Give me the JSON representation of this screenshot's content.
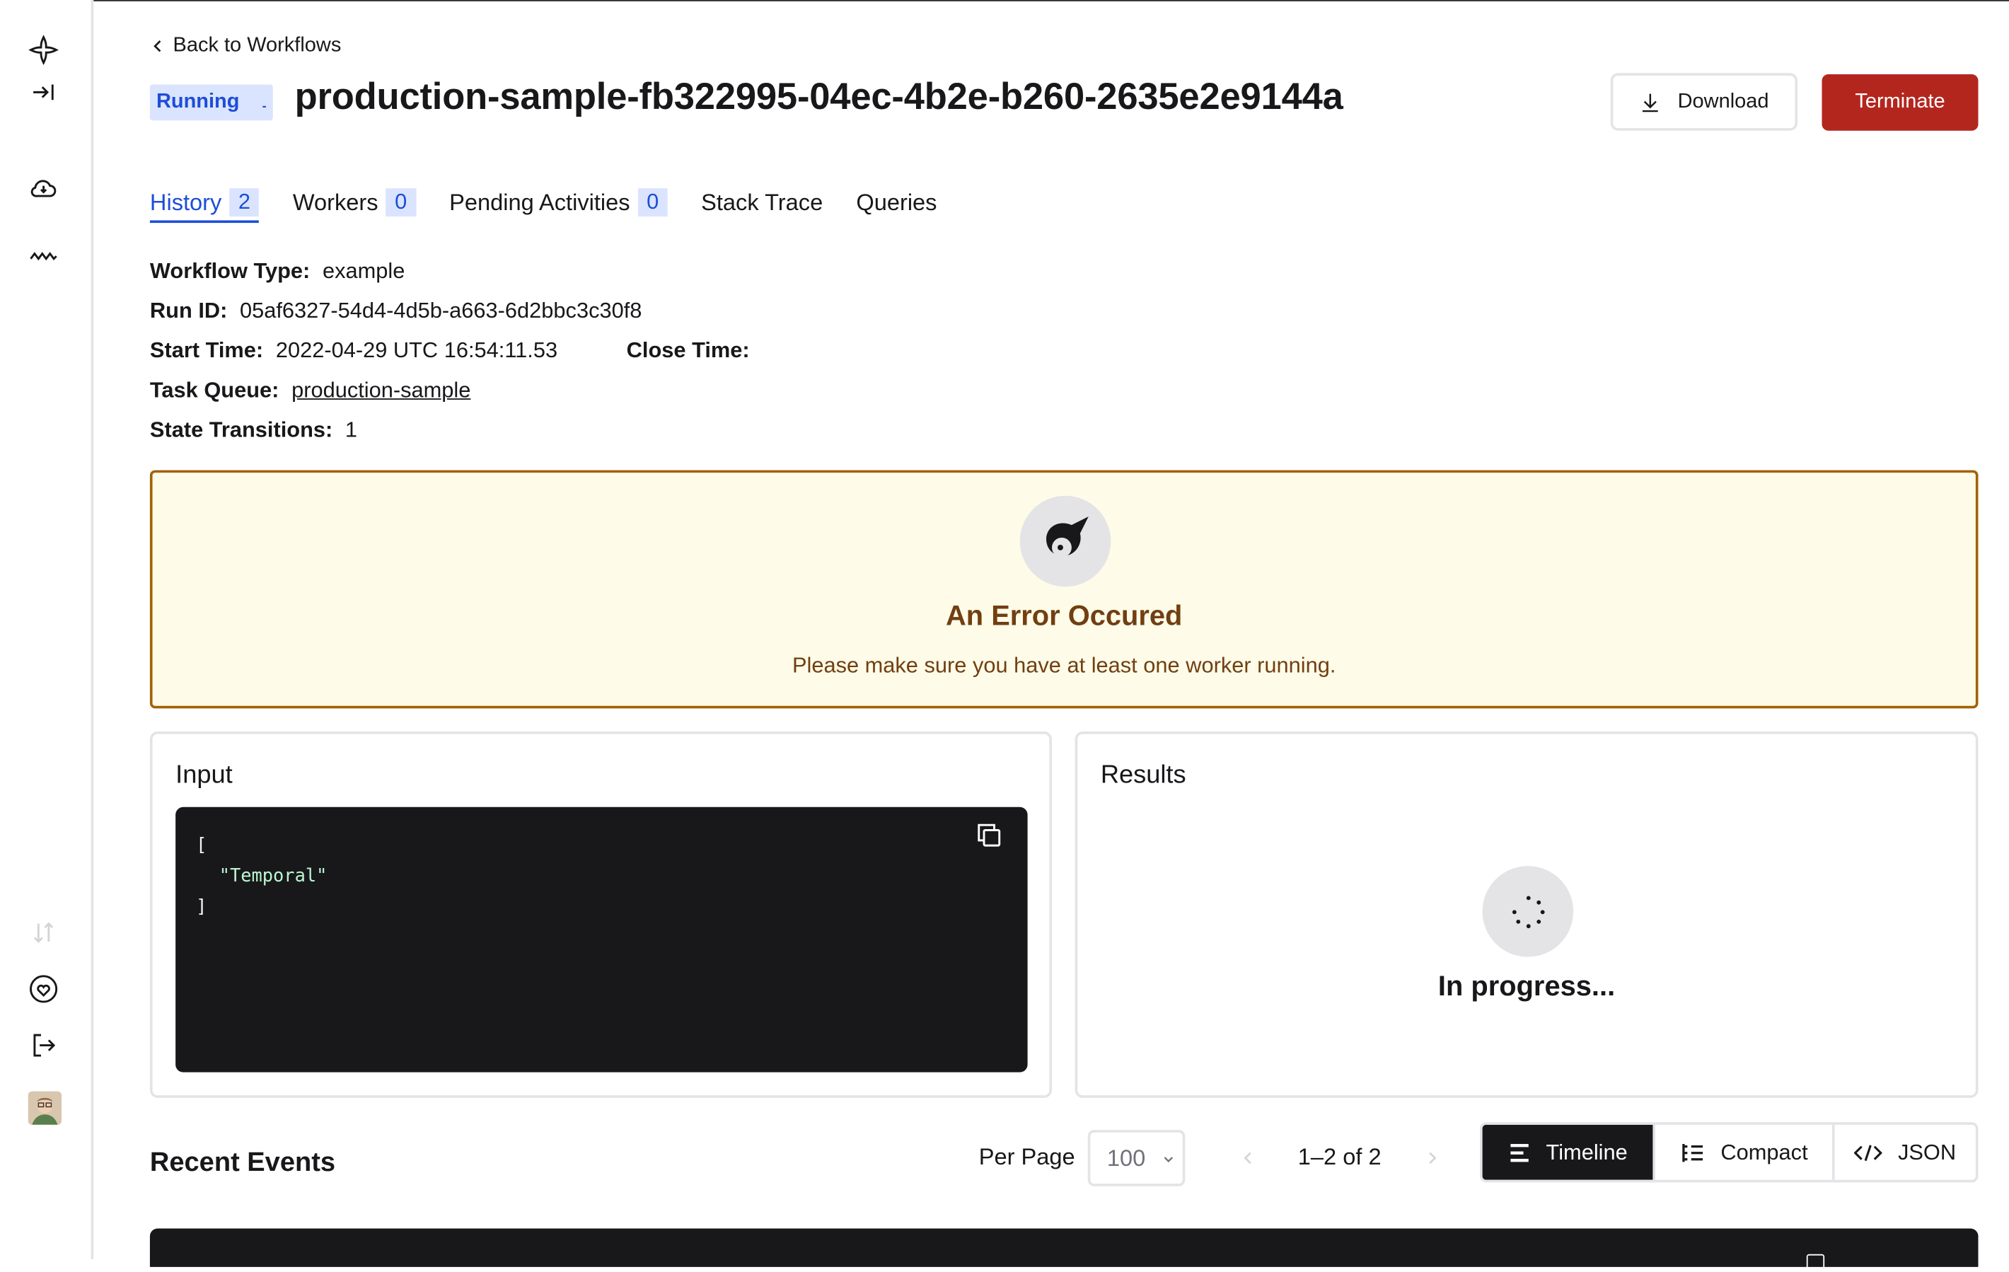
{
  "header": {
    "back_label": "Back to Workflows",
    "status": "Running",
    "title": "production-sample-fb322995-04ec-4b2e-b260-2635e2e9144a",
    "download_label": "Download",
    "terminate_label": "Terminate"
  },
  "tabs": [
    {
      "label": "History",
      "count": "2",
      "active": true
    },
    {
      "label": "Workers",
      "count": "0"
    },
    {
      "label": "Pending Activities",
      "count": "0"
    },
    {
      "label": "Stack Trace"
    },
    {
      "label": "Queries"
    }
  ],
  "details": {
    "workflow_type_label": "Workflow Type:",
    "workflow_type": "example",
    "run_id_label": "Run ID:",
    "run_id": "05af6327-54d4-4d5b-a663-6d2bbc3c30f8",
    "start_time_label": "Start Time:",
    "start_time": "2022-04-29 UTC 16:54:11.53",
    "close_time_label": "Close Time:",
    "close_time": "",
    "task_queue_label": "Task Queue:",
    "task_queue": "production-sample",
    "state_transitions_label": "State Transitions:",
    "state_transitions": "1"
  },
  "error": {
    "title": "An Error Occured",
    "message": "Please make sure you have at least one worker running."
  },
  "input": {
    "title": "Input",
    "open": "[",
    "value": "\"Temporal\"",
    "close": "]"
  },
  "results": {
    "title": "Results",
    "status": "In progress..."
  },
  "events": {
    "title": "Recent Events",
    "per_page_label": "Per Page",
    "per_page": "100",
    "pagination": "1–2 of 2",
    "views": [
      "Timeline",
      "Compact",
      "JSON"
    ],
    "active_view": "Timeline"
  },
  "icons": {
    "sidebar_top": [
      "logo-icon",
      "collapse-icon",
      "cloud-icon",
      "activity-icon"
    ],
    "sidebar_bottom": [
      "sort-icon",
      "heart-icon",
      "logout-icon",
      "avatar"
    ]
  },
  "colors": {
    "accent": "#1d4ed8",
    "danger": "#b3261e",
    "warning_border": "#a16207",
    "warning_bg": "#fefce8",
    "dark": "#18181b"
  }
}
